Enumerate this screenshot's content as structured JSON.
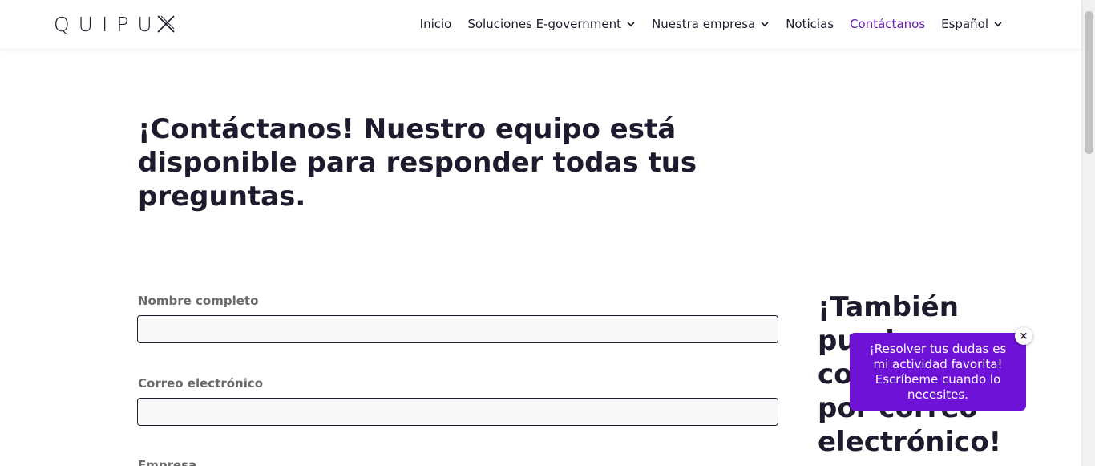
{
  "header": {
    "logo_text": "QUIPU",
    "nav": [
      {
        "label": "Inicio",
        "dropdown": false,
        "active": false
      },
      {
        "label": "Soluciones E-government",
        "dropdown": true,
        "active": false
      },
      {
        "label": "Nuestra empresa",
        "dropdown": true,
        "active": false
      },
      {
        "label": "Noticias",
        "dropdown": false,
        "active": false
      },
      {
        "label": "Contáctanos",
        "dropdown": false,
        "active": true
      },
      {
        "label": "Español",
        "dropdown": true,
        "active": false
      }
    ]
  },
  "main": {
    "title": "¡Contáctanos! Nuestro equipo está disponible para responder todas tus preguntas.",
    "form": {
      "fields": [
        {
          "label": "Nombre completo",
          "value": ""
        },
        {
          "label": "Correo electrónico",
          "value": ""
        },
        {
          "label": "Empresa",
          "value": ""
        }
      ]
    },
    "side_title": "¡También puedes contactarnos por correo electrónico!"
  },
  "chat": {
    "message": "¡Resolver tus dudas es mi actividad favorita! Escríbeme cuando lo necesites.",
    "close_glyph": "×"
  },
  "colors": {
    "text": "#1e1b2e",
    "accent": "#6a1bb0",
    "chat_bg": "#6f12d8"
  }
}
